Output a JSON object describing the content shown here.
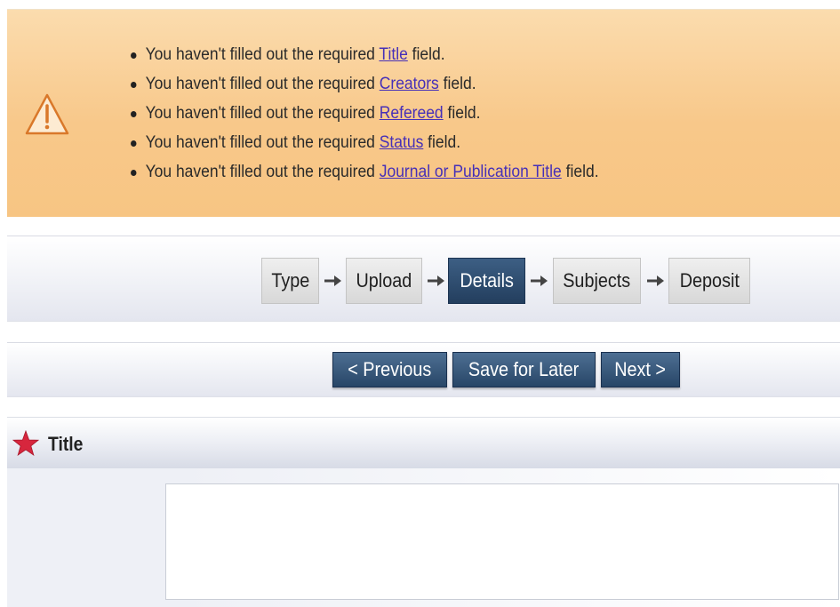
{
  "warnings": [
    {
      "before": "You haven't filled out the required ",
      "field": "Title",
      "after": " field."
    },
    {
      "before": "You haven't filled out the required ",
      "field": "Creators",
      "after": " field."
    },
    {
      "before": "You haven't filled out the required ",
      "field": "Refereed",
      "after": " field."
    },
    {
      "before": "You haven't filled out the required ",
      "field": "Status",
      "after": " field."
    },
    {
      "before": "You haven't filled out the required ",
      "field": "Journal or Publication Title",
      "after": " field."
    }
  ],
  "workflow": {
    "steps": [
      "Type",
      "Upload",
      "Details",
      "Subjects",
      "Deposit"
    ],
    "active": "Details"
  },
  "nav": {
    "previous": "< Previous",
    "save_later": "Save for Later",
    "next": "Next >"
  },
  "field": {
    "label": "Title",
    "value": ""
  },
  "colors": {
    "warning_bg": "#f8c88a",
    "link": "#4630b8",
    "active_step": "#233e5e",
    "button": "#284667",
    "required_star": "#d7263d"
  },
  "icons": {
    "warning": "warning-triangle-icon",
    "arrow": "right-arrow-icon",
    "required": "required-star-icon"
  }
}
